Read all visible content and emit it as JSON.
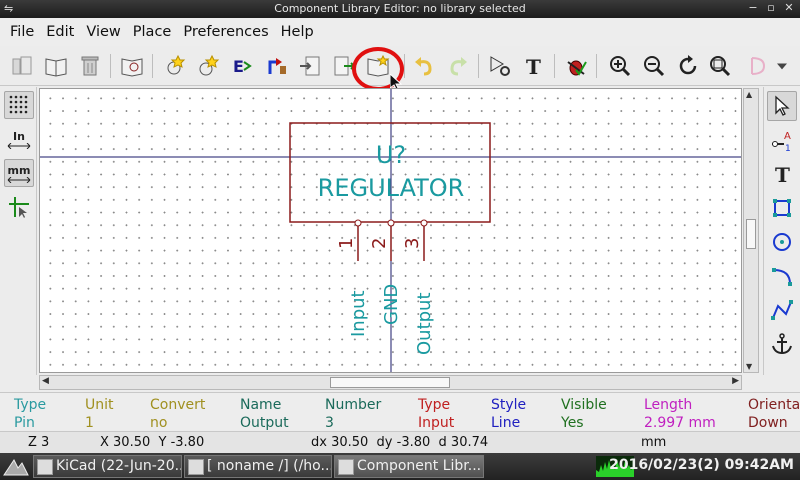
{
  "window": {
    "title": "Component Library Editor: no library selected"
  },
  "menu": [
    {
      "label": "File"
    },
    {
      "label": "Edit"
    },
    {
      "label": "View"
    },
    {
      "label": "Place"
    },
    {
      "label": "Preferences"
    },
    {
      "label": "Help"
    }
  ],
  "left_toolbar": {
    "units_in": "In",
    "units_mm": "mm"
  },
  "component": {
    "reference": "U?",
    "value": "REGULATOR",
    "pins": [
      {
        "number": "1",
        "name": "Input"
      },
      {
        "number": "2",
        "name": "GND"
      },
      {
        "number": "3",
        "name": "Output"
      }
    ]
  },
  "message_panel": [
    {
      "label": "Type",
      "value": "Pin",
      "color": "#2a9aa0"
    },
    {
      "label": "Unit",
      "value": "1",
      "color": "#a09020"
    },
    {
      "label": "Convert",
      "value": "no",
      "color": "#a09020"
    },
    {
      "label": "Name",
      "value": "Output",
      "color": "#1a6a5a"
    },
    {
      "label": "Number",
      "value": "3",
      "color": "#1a6a5a"
    },
    {
      "label": "Type",
      "value": "Input",
      "color": "#c02020"
    },
    {
      "label": "Style",
      "value": "Line",
      "color": "#2020c0"
    },
    {
      "label": "Visible",
      "value": "Yes",
      "color": "#207020"
    },
    {
      "label": "Length",
      "value": "2.997 mm",
      "color": "#c020c0"
    },
    {
      "label": "Orienta",
      "value": "Down",
      "color": "#802020"
    }
  ],
  "status": {
    "zoom": "Z 3",
    "xy": "X 30.50  Y -3.80",
    "delta": "dx 30.50  dy -3.80  d 30.74",
    "units": "mm"
  },
  "taskbar": {
    "tasks": [
      {
        "label": "KiCad (22-Jun-20..."
      },
      {
        "label": "[ noname /] (/ho..."
      },
      {
        "label": "Component Libr..."
      }
    ],
    "clock": "2016/02/23(2) 09:42AM"
  }
}
